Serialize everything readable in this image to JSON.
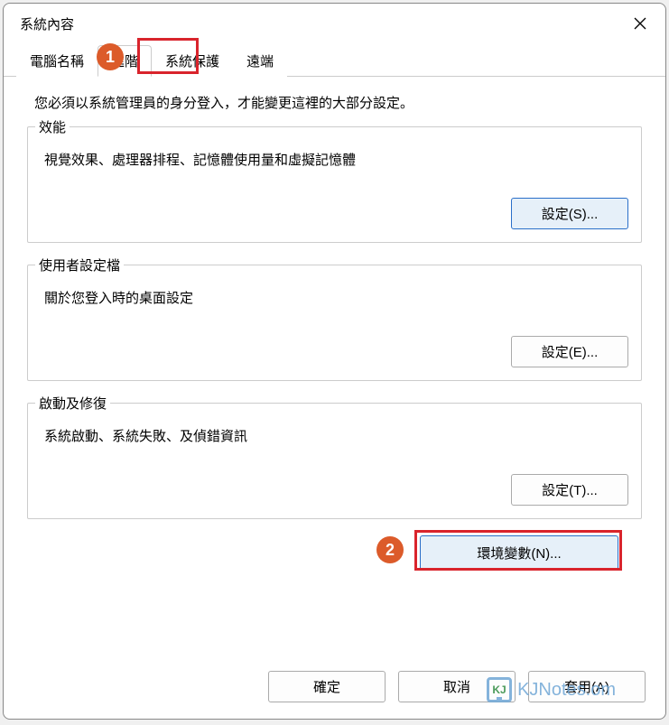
{
  "dialog": {
    "title": "系統內容"
  },
  "tabs": {
    "computer_name": "電腦名稱",
    "advanced": "進階",
    "system_protection": "系統保護",
    "remote": "遠端"
  },
  "content": {
    "admin_note": "您必須以系統管理員的身分登入，才能變更這裡的大部分設定。",
    "performance": {
      "title": "效能",
      "desc": "視覺效果、處理器排程、記憶體使用量和虛擬記憶體",
      "button": "設定(S)..."
    },
    "user_profiles": {
      "title": "使用者設定檔",
      "desc": "關於您登入時的桌面設定",
      "button": "設定(E)..."
    },
    "startup_recovery": {
      "title": "啟動及修復",
      "desc": "系統啟動、系統失敗、及偵錯資訊",
      "button": "設定(T)..."
    },
    "env_vars_button": "環境變數(N)..."
  },
  "footer": {
    "ok": "確定",
    "cancel": "取消",
    "apply": "套用(A)"
  },
  "annotations": {
    "badge1": "1",
    "badge2": "2"
  },
  "watermark": {
    "icon_text": "KJ",
    "text": "KJNotes.om"
  }
}
